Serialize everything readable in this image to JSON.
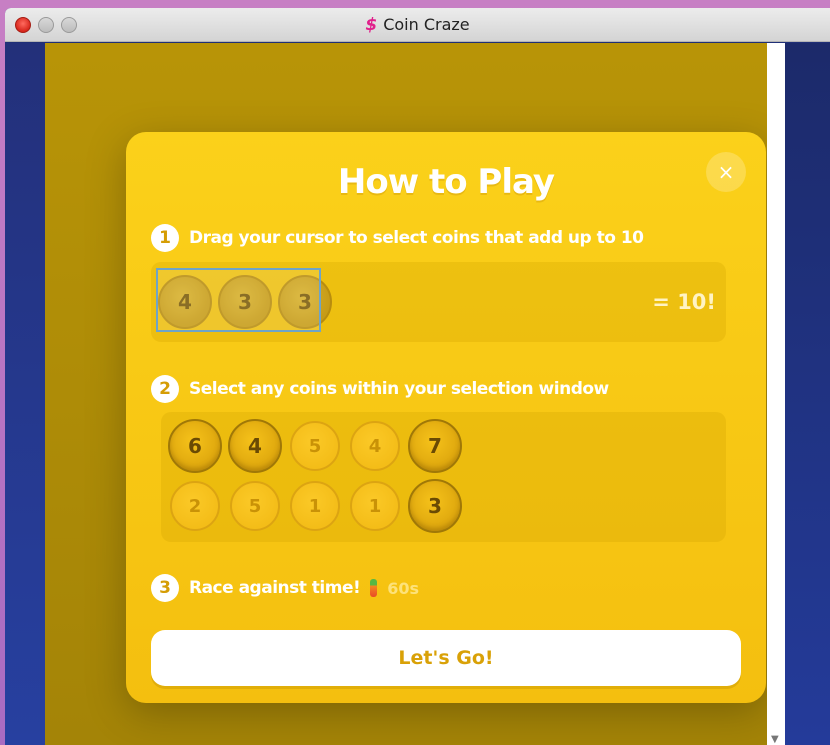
{
  "window": {
    "title": "Coin Craze",
    "app_icon": "dollar-icon"
  },
  "modal": {
    "title": "How to Play",
    "close_label": "×",
    "steps": [
      {
        "number": "1",
        "text": "Drag your cursor to select coins that add up to 10"
      },
      {
        "number": "2",
        "text": "Select any coins within your selection window"
      },
      {
        "number": "3",
        "text": "Race against time!",
        "timer": "60s"
      }
    ],
    "demo1": {
      "coins": [
        "4",
        "3",
        "3"
      ],
      "result": "= 10!"
    },
    "demo2": {
      "row1": [
        "6",
        "4",
        "5",
        "4",
        "7"
      ],
      "row2": [
        "2",
        "5",
        "1",
        "1",
        "3"
      ]
    },
    "go_button": "Let's Go!"
  },
  "colors": {
    "modal": "#f9c914",
    "game_bg": "#b18f07",
    "accent_text": "#d9a107"
  }
}
